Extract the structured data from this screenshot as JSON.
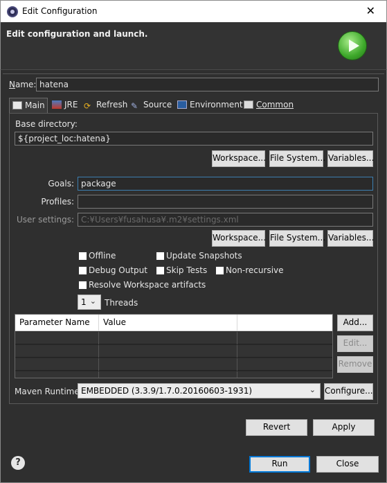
{
  "window": {
    "title": "Edit Configuration",
    "close_glyph": "✕"
  },
  "header": {
    "title": "Edit configuration and launch."
  },
  "name": {
    "label_prefix": "",
    "label_u": "N",
    "label_rest": "ame:",
    "value": "hatena"
  },
  "tabs": [
    {
      "label": "Main"
    },
    {
      "label": "JRE"
    },
    {
      "label": "Refresh"
    },
    {
      "label": "Source"
    },
    {
      "label": "Environment"
    },
    {
      "label": "Common"
    }
  ],
  "base_directory": {
    "label": "Base directory:",
    "value": "${project_loc:hatena}"
  },
  "buttons": {
    "workspace": "Workspace...",
    "file_system": "File System...",
    "variables": "Variables...",
    "add": "Add...",
    "edit": "Edit...",
    "remove": "Remove",
    "configure": "Configure...",
    "revert": "Revert",
    "apply": "Apply",
    "run": "Run",
    "close": "Close"
  },
  "goals": {
    "label": "Goals:",
    "value": "package"
  },
  "profiles": {
    "label": "Profiles:",
    "value": ""
  },
  "user_settings": {
    "label": "User settings:",
    "placeholder": "C:¥Users¥fusahusa¥.m2¥settings.xml"
  },
  "checkboxes": {
    "offline": "Offline",
    "update_snapshots": "Update Snapshots",
    "debug_output": "Debug Output",
    "skip_tests": "Skip Tests",
    "non_recursive": "Non-recursive",
    "resolve_workspace": "Resolve Workspace artifacts"
  },
  "threads": {
    "value": "1",
    "label": "Threads"
  },
  "parameters_table": {
    "columns": [
      "Parameter Name",
      "Value",
      ""
    ]
  },
  "maven_runtime": {
    "label": "Maven Runtime:",
    "value": "EMBEDDED (3.3.9/1.7.0.20160603-1931)"
  },
  "help": {
    "glyph": "?"
  }
}
